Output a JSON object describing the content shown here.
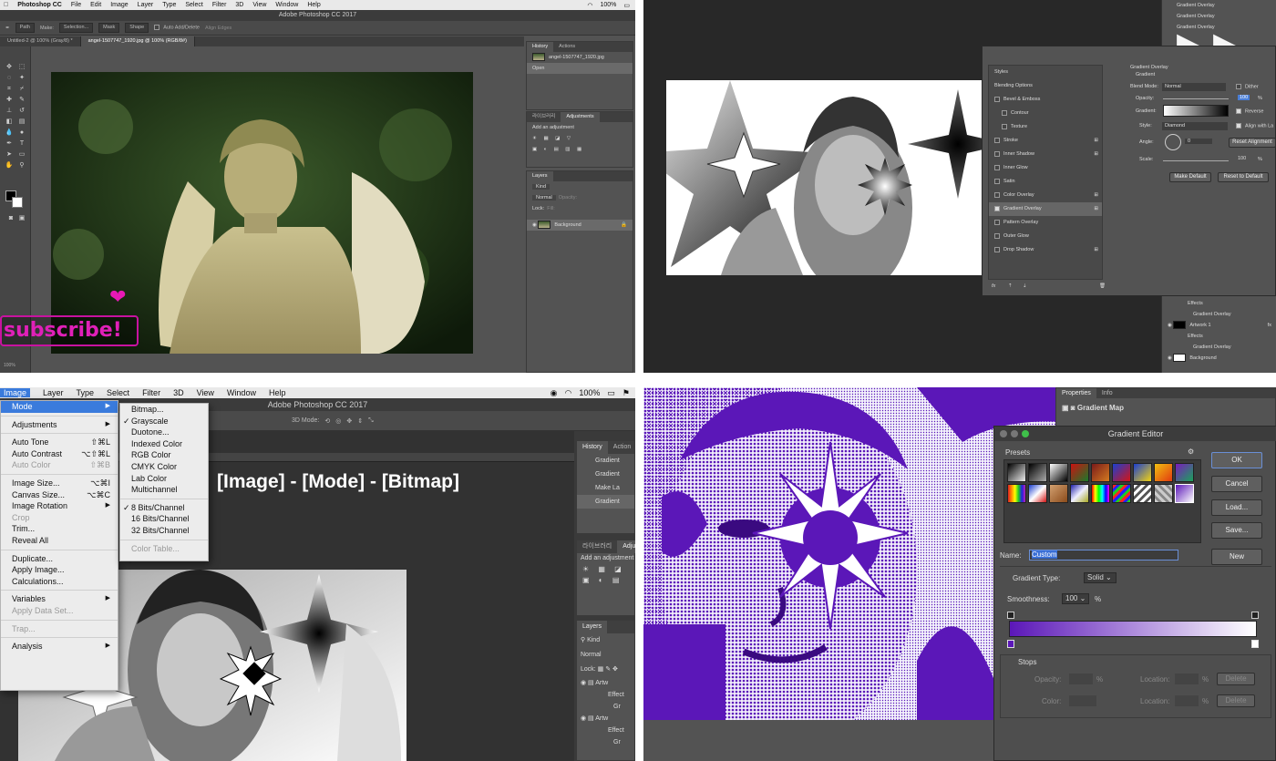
{
  "q1": {
    "menubar": [
      "Photoshop CC",
      "File",
      "Edit",
      "Image",
      "Layer",
      "Type",
      "Select",
      "Filter",
      "3D",
      "View",
      "Window",
      "Help"
    ],
    "battery": "100%",
    "title": "Adobe Photoshop CC 2017",
    "options": {
      "mode": "Path",
      "make": "Make:",
      "selection": "Selection...",
      "mask": "Mask",
      "shape": "Shape",
      "auto_add": "Auto Add/Delete",
      "align_edges": "Align Edges"
    },
    "doc_tabs": [
      "Untitled-2 @ 100% (Gray/8) *",
      "angel-1507747_1920.jpg @ 100% (RGB/8#)"
    ],
    "history": {
      "tabs": [
        "History",
        "Actions"
      ],
      "items": [
        "angel-1507747_1920.jpg",
        "Open"
      ]
    },
    "adjustments": {
      "tabs": [
        "라이브러리",
        "Adjustments"
      ],
      "hint": "Add an adjustment"
    },
    "layers": {
      "tab": "Layers",
      "kind": "Kind",
      "blend": "Normal",
      "opacity": "Opacity:",
      "lock": "Lock:",
      "fill": "Fill:",
      "layer": "Background"
    },
    "overlay_text": "subscribe!",
    "status": "100%"
  },
  "q2": {
    "styles_title": "Styles",
    "styles": [
      "Blending Options",
      "Bevel & Emboss",
      "Contour",
      "Texture",
      "Stroke",
      "Inner Shadow",
      "Inner Glow",
      "Satin",
      "Color Overlay",
      "Gradient Overlay",
      "Pattern Overlay",
      "Outer Glow",
      "Drop Shadow"
    ],
    "go_title": "Gradient Overlay",
    "go_sub": "Gradient",
    "blend_label": "Blend Mode:",
    "blend_value": "Normal",
    "dither": "Dither",
    "opacity_label": "Opacity:",
    "opacity_value": "100",
    "pct": "%",
    "gradient_label": "Gradient:",
    "reverse": "Reverse",
    "style_label": "Style:",
    "style_value": "Diamond",
    "align": "Align with La",
    "angle_label": "Angle:",
    "angle_value": "0",
    "reset_align": "Reset Alignment",
    "scale_label": "Scale:",
    "scale_value": "100",
    "make_default": "Make Default",
    "reset_default": "Reset to Default",
    "fx": "fx",
    "layer_rows": [
      "Gradient Overlay",
      "Gradient Overlay",
      "Gradient Overlay",
      "Effects",
      "Gradient Overlay",
      "Artwork 1",
      "Effects",
      "Gradient Overlay",
      "Background"
    ]
  },
  "q3": {
    "menubar": [
      "Image",
      "Layer",
      "Type",
      "Select",
      "Filter",
      "3D",
      "View",
      "Window",
      "Help"
    ],
    "battery": "100%",
    "title": "Adobe Photoshop CC 2017",
    "three_d": "3D Mode:",
    "heading": "[Image] - [Mode] - [Bitmap]",
    "image_menu": [
      {
        "label": "Mode",
        "sc": "",
        "hl": true,
        "sub": true
      },
      {
        "sep": true
      },
      {
        "label": "Adjustments",
        "sc": "",
        "sub": true
      },
      {
        "sep": true
      },
      {
        "label": "Auto Tone",
        "sc": "⇧⌘L"
      },
      {
        "label": "Auto Contrast",
        "sc": "⌥⇧⌘L"
      },
      {
        "label": "Auto Color",
        "sc": "⇧⌘B",
        "dis": true
      },
      {
        "sep": true
      },
      {
        "label": "Image Size...",
        "sc": "⌥⌘I"
      },
      {
        "label": "Canvas Size...",
        "sc": "⌥⌘C"
      },
      {
        "label": "Image Rotation",
        "sc": "",
        "sub": true
      },
      {
        "label": "Crop",
        "sc": "",
        "dis": true
      },
      {
        "label": "Trim...",
        "sc": ""
      },
      {
        "label": "Reveal All",
        "sc": ""
      },
      {
        "sep": true
      },
      {
        "label": "Duplicate...",
        "sc": ""
      },
      {
        "label": "Apply Image...",
        "sc": ""
      },
      {
        "label": "Calculations...",
        "sc": ""
      },
      {
        "sep": true
      },
      {
        "label": "Variables",
        "sc": "",
        "sub": true
      },
      {
        "label": "Apply Data Set...",
        "sc": "",
        "dis": true
      },
      {
        "sep": true
      },
      {
        "label": "Trap...",
        "sc": "",
        "dis": true
      },
      {
        "sep": true
      },
      {
        "label": "Analysis",
        "sc": "",
        "sub": true
      }
    ],
    "mode_menu": [
      {
        "label": "Bitmap..."
      },
      {
        "label": "Grayscale",
        "check": true
      },
      {
        "label": "Duotone..."
      },
      {
        "label": "Indexed Color"
      },
      {
        "label": "RGB Color"
      },
      {
        "label": "CMYK Color"
      },
      {
        "label": "Lab Color"
      },
      {
        "label": "Multichannel"
      },
      {
        "sep": true
      },
      {
        "label": "8 Bits/Channel",
        "check": true
      },
      {
        "label": "16 Bits/Channel"
      },
      {
        "label": "32 Bits/Channel"
      },
      {
        "sep": true
      },
      {
        "label": "Color Table...",
        "dis": true
      }
    ],
    "history": {
      "tabs": [
        "History",
        "Action"
      ],
      "items": [
        "Gradient",
        "Gradient",
        "Make La",
        "Gradient"
      ]
    },
    "adjust": {
      "tabs": [
        "라이브러리",
        "Adjus"
      ],
      "hint": "Add an adjustment"
    },
    "layers": {
      "tab": "Layers",
      "kind": "Kind",
      "blend": "Normal",
      "lock": "Lock:",
      "rows": [
        "Artw",
        "Effect",
        "Gr",
        "Artw",
        "Effect",
        "Gr"
      ]
    }
  },
  "q4": {
    "props": {
      "tabs": [
        "Properties",
        "Info"
      ],
      "label": "Gradient Map"
    },
    "title": "Gradient Editor",
    "presets": "Presets",
    "ok": "OK",
    "cancel": "Cancel",
    "load": "Load...",
    "save": "Save...",
    "new": "New",
    "name_label": "Name:",
    "name_value": "Custom",
    "type_label": "Gradient Type:",
    "type_value": "Solid",
    "smooth_label": "Smoothness:",
    "smooth_value": "100",
    "pct": "%",
    "stops": "Stops",
    "opacity_label": "Opacity:",
    "location_label": "Location:",
    "color_label": "Color:",
    "delete": "Delete",
    "accent": "#5b17b8"
  }
}
